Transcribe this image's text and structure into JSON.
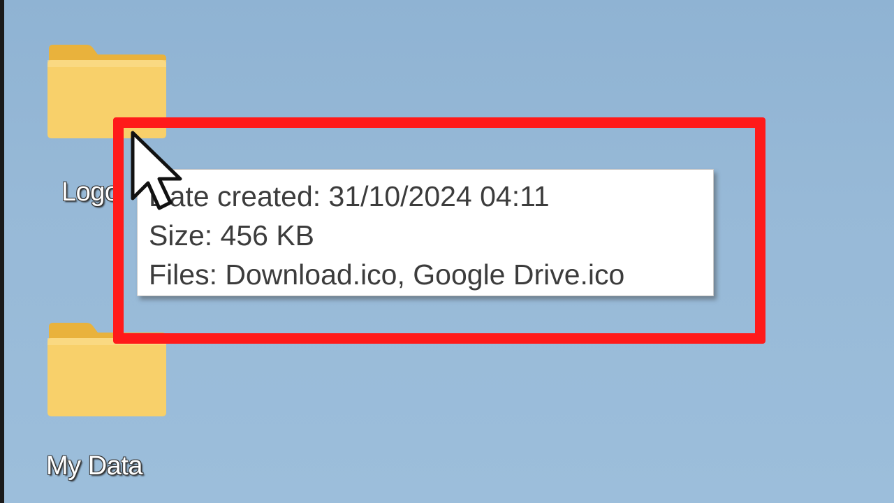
{
  "desktop": {
    "icons": [
      {
        "label": "Logo",
        "icon": "folder-icon"
      },
      {
        "label": "My Data",
        "icon": "folder-icon"
      }
    ]
  },
  "tooltip": {
    "date_created": "Date created: 31/10/2024 04:11",
    "size": "Size: 456 KB",
    "files": "Files: Download.ico, Google Drive.ico"
  },
  "colors": {
    "highlight": "#ff1a1a",
    "folder": "#f7cf63",
    "desktop_bg": "#97b9d7"
  }
}
